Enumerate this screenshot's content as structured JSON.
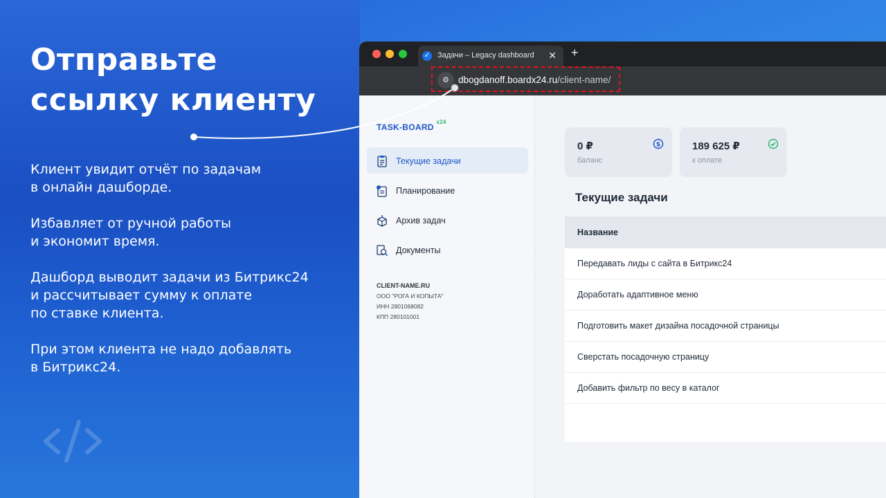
{
  "slide": {
    "headline_line1": "Отправьте",
    "headline_line2": "ссылку клиенту",
    "paragraphs": [
      [
        "Клиент увидит отчёт по задачам",
        "в онлайн дашборде."
      ],
      [
        "Избавляет от ручной работы",
        "и экономит время."
      ],
      [
        "Дашборд выводит задачи из Битрикс24",
        "и рассчитывает сумму к оплате",
        "по ставке клиента."
      ],
      [
        "При этом клиента не надо добавлять",
        "в Битрикс24."
      ]
    ],
    "logo_icon": "code-brackets-icon",
    "highlight_color": "#e0141e"
  },
  "browser": {
    "tab_title": "Задачи – Legacy dashboard",
    "tab_close": "✕",
    "new_tab": "+",
    "url_domain": "dbogdanoff.boardx24.ru",
    "url_path": "/client-name/"
  },
  "app": {
    "brand": "TASK-BOARD",
    "brand_suffix": "x24",
    "nav": [
      {
        "label": "Текущие задачи",
        "icon": "clipboard-list-icon",
        "active": true
      },
      {
        "label": "Планирование",
        "icon": "calendar-plan-icon",
        "active": false
      },
      {
        "label": "Архив задач",
        "icon": "archive-box-icon",
        "active": false
      },
      {
        "label": "Документы",
        "icon": "documents-search-icon",
        "active": false
      }
    ],
    "org": {
      "name": "CLIENT-NAME.RU",
      "company": "ООО \"РОГА И КОПЫТА\"",
      "inn": "ИНН 2801068082",
      "kpp": "КПП 280101001"
    },
    "cards": [
      {
        "value": "0 ₽",
        "label": "баланс",
        "icon": "dollar-circle-icon",
        "color": "#1e57c8"
      },
      {
        "value": "189 625 ₽",
        "label": "к оплате",
        "icon": "check-circle-icon",
        "color": "#2bb673"
      }
    ],
    "section_title": "Текущие задачи",
    "table": {
      "header": "Название",
      "rows": [
        "Передавать лиды с сайта в Битрикс24",
        "Доработать адаптивное меню",
        "Подготовить макет дизайна посадочной страницы",
        "Сверстать посадочную страницу",
        "Добавить фильтр по весу в каталог"
      ]
    }
  }
}
